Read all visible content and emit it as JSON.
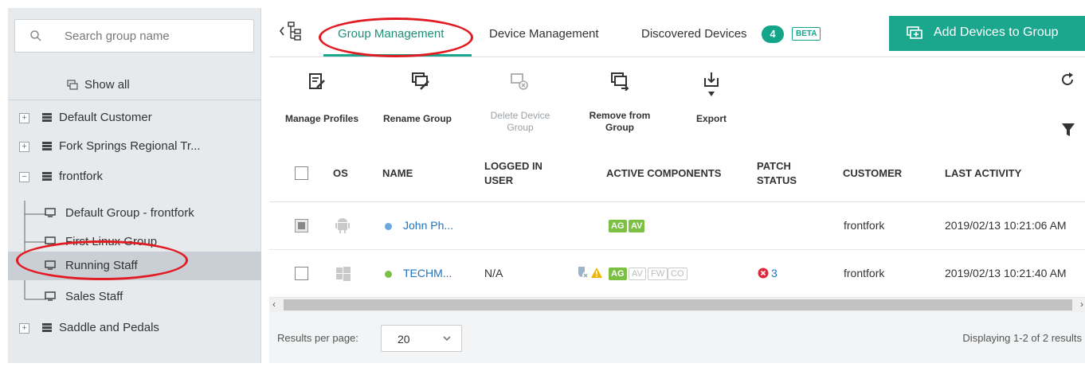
{
  "sidebar": {
    "search_placeholder": "Search group name",
    "show_all": "Show all",
    "items": [
      {
        "label": "Default Customer",
        "expander": "+"
      },
      {
        "label": "Fork Springs Regional Tr...",
        "expander": "+"
      },
      {
        "label": "frontfork",
        "expander": "−"
      },
      {
        "label": "Default Group - frontfork"
      },
      {
        "label": "First Linux Group"
      },
      {
        "label": "Running Staff"
      },
      {
        "label": "Sales Staff"
      },
      {
        "label": "Saddle and Pedals",
        "expander": "+"
      }
    ]
  },
  "tabs": {
    "group_management": "Group Management",
    "device_management": "Device Management",
    "discovered_devices": "Discovered Devices",
    "discovered_count": "4",
    "beta": "BETA"
  },
  "add_button": "Add Devices to Group",
  "toolbar": {
    "manage_profiles": "Manage Profiles",
    "rename_group": "Rename Group",
    "delete_device_group_1": "Delete Device",
    "delete_device_group_2": "Group",
    "remove_from_group_1": "Remove from",
    "remove_from_group_2": "Group",
    "export": "Export"
  },
  "table": {
    "headers": {
      "os": "OS",
      "name": "NAME",
      "logged_in_1": "LOGGED IN",
      "logged_in_2": "USER",
      "active_components": "ACTIVE COMPONENTS",
      "patch_1": "PATCH",
      "patch_2": "STATUS",
      "customer": "CUSTOMER",
      "last_activity": "LAST ACTIVITY"
    },
    "rows": [
      {
        "os": "android",
        "status_color": "#6aa8e0",
        "name": "John Ph...",
        "logged_in": "",
        "components": [
          "AG",
          "AV"
        ],
        "patch": "",
        "customer": "frontfork",
        "last_activity": "2019/02/13 10:21:06 AM"
      },
      {
        "os": "windows",
        "status_color": "#7bc043",
        "name": "TECHM...",
        "logged_in": "N/A",
        "components_on": [
          "AG"
        ],
        "components_off": [
          "AV",
          "FW",
          "CO"
        ],
        "patch": "3",
        "customer": "frontfork",
        "last_activity": "2019/02/13 10:21:40 AM"
      }
    ]
  },
  "footer": {
    "results_per_page_label": "Results per page:",
    "results_per_page_value": "20",
    "displaying": "Displaying 1-2 of 2 results"
  },
  "colors": {
    "accent": "#1aa78e",
    "annotation": "#e21b23"
  }
}
